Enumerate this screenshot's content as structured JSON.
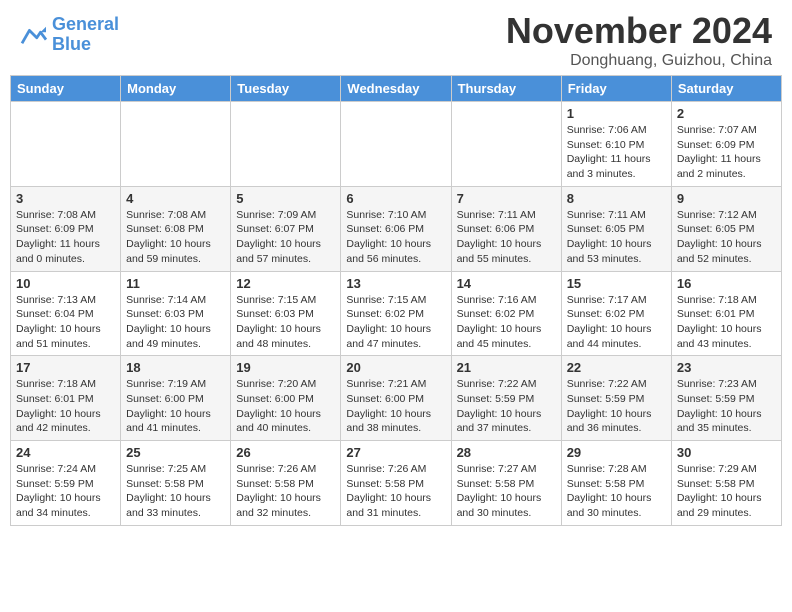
{
  "header": {
    "logo_line1": "General",
    "logo_line2": "Blue",
    "month_title": "November 2024",
    "location": "Donghuang, Guizhou, China"
  },
  "weekdays": [
    "Sunday",
    "Monday",
    "Tuesday",
    "Wednesday",
    "Thursday",
    "Friday",
    "Saturday"
  ],
  "weeks": [
    [
      {
        "day": "",
        "info": ""
      },
      {
        "day": "",
        "info": ""
      },
      {
        "day": "",
        "info": ""
      },
      {
        "day": "",
        "info": ""
      },
      {
        "day": "",
        "info": ""
      },
      {
        "day": "1",
        "info": "Sunrise: 7:06 AM\nSunset: 6:10 PM\nDaylight: 11 hours\nand 3 minutes."
      },
      {
        "day": "2",
        "info": "Sunrise: 7:07 AM\nSunset: 6:09 PM\nDaylight: 11 hours\nand 2 minutes."
      }
    ],
    [
      {
        "day": "3",
        "info": "Sunrise: 7:08 AM\nSunset: 6:09 PM\nDaylight: 11 hours\nand 0 minutes."
      },
      {
        "day": "4",
        "info": "Sunrise: 7:08 AM\nSunset: 6:08 PM\nDaylight: 10 hours\nand 59 minutes."
      },
      {
        "day": "5",
        "info": "Sunrise: 7:09 AM\nSunset: 6:07 PM\nDaylight: 10 hours\nand 57 minutes."
      },
      {
        "day": "6",
        "info": "Sunrise: 7:10 AM\nSunset: 6:06 PM\nDaylight: 10 hours\nand 56 minutes."
      },
      {
        "day": "7",
        "info": "Sunrise: 7:11 AM\nSunset: 6:06 PM\nDaylight: 10 hours\nand 55 minutes."
      },
      {
        "day": "8",
        "info": "Sunrise: 7:11 AM\nSunset: 6:05 PM\nDaylight: 10 hours\nand 53 minutes."
      },
      {
        "day": "9",
        "info": "Sunrise: 7:12 AM\nSunset: 6:05 PM\nDaylight: 10 hours\nand 52 minutes."
      }
    ],
    [
      {
        "day": "10",
        "info": "Sunrise: 7:13 AM\nSunset: 6:04 PM\nDaylight: 10 hours\nand 51 minutes."
      },
      {
        "day": "11",
        "info": "Sunrise: 7:14 AM\nSunset: 6:03 PM\nDaylight: 10 hours\nand 49 minutes."
      },
      {
        "day": "12",
        "info": "Sunrise: 7:15 AM\nSunset: 6:03 PM\nDaylight: 10 hours\nand 48 minutes."
      },
      {
        "day": "13",
        "info": "Sunrise: 7:15 AM\nSunset: 6:02 PM\nDaylight: 10 hours\nand 47 minutes."
      },
      {
        "day": "14",
        "info": "Sunrise: 7:16 AM\nSunset: 6:02 PM\nDaylight: 10 hours\nand 45 minutes."
      },
      {
        "day": "15",
        "info": "Sunrise: 7:17 AM\nSunset: 6:02 PM\nDaylight: 10 hours\nand 44 minutes."
      },
      {
        "day": "16",
        "info": "Sunrise: 7:18 AM\nSunset: 6:01 PM\nDaylight: 10 hours\nand 43 minutes."
      }
    ],
    [
      {
        "day": "17",
        "info": "Sunrise: 7:18 AM\nSunset: 6:01 PM\nDaylight: 10 hours\nand 42 minutes."
      },
      {
        "day": "18",
        "info": "Sunrise: 7:19 AM\nSunset: 6:00 PM\nDaylight: 10 hours\nand 41 minutes."
      },
      {
        "day": "19",
        "info": "Sunrise: 7:20 AM\nSunset: 6:00 PM\nDaylight: 10 hours\nand 40 minutes."
      },
      {
        "day": "20",
        "info": "Sunrise: 7:21 AM\nSunset: 6:00 PM\nDaylight: 10 hours\nand 38 minutes."
      },
      {
        "day": "21",
        "info": "Sunrise: 7:22 AM\nSunset: 5:59 PM\nDaylight: 10 hours\nand 37 minutes."
      },
      {
        "day": "22",
        "info": "Sunrise: 7:22 AM\nSunset: 5:59 PM\nDaylight: 10 hours\nand 36 minutes."
      },
      {
        "day": "23",
        "info": "Sunrise: 7:23 AM\nSunset: 5:59 PM\nDaylight: 10 hours\nand 35 minutes."
      }
    ],
    [
      {
        "day": "24",
        "info": "Sunrise: 7:24 AM\nSunset: 5:59 PM\nDaylight: 10 hours\nand 34 minutes."
      },
      {
        "day": "25",
        "info": "Sunrise: 7:25 AM\nSunset: 5:58 PM\nDaylight: 10 hours\nand 33 minutes."
      },
      {
        "day": "26",
        "info": "Sunrise: 7:26 AM\nSunset: 5:58 PM\nDaylight: 10 hours\nand 32 minutes."
      },
      {
        "day": "27",
        "info": "Sunrise: 7:26 AM\nSunset: 5:58 PM\nDaylight: 10 hours\nand 31 minutes."
      },
      {
        "day": "28",
        "info": "Sunrise: 7:27 AM\nSunset: 5:58 PM\nDaylight: 10 hours\nand 30 minutes."
      },
      {
        "day": "29",
        "info": "Sunrise: 7:28 AM\nSunset: 5:58 PM\nDaylight: 10 hours\nand 30 minutes."
      },
      {
        "day": "30",
        "info": "Sunrise: 7:29 AM\nSunset: 5:58 PM\nDaylight: 10 hours\nand 29 minutes."
      }
    ]
  ]
}
